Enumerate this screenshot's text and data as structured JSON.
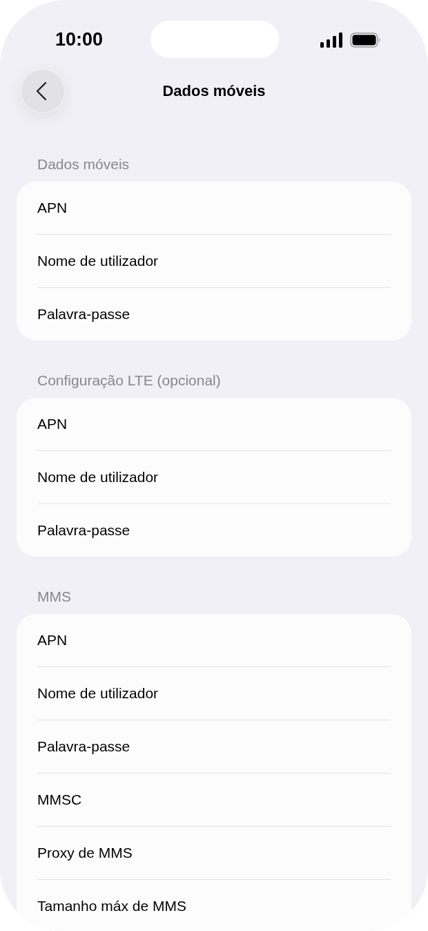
{
  "status_bar": {
    "time": "10:00"
  },
  "nav": {
    "title": "Dados móveis"
  },
  "sections": [
    {
      "header": "Dados móveis",
      "rows": [
        "APN",
        "Nome de utilizador",
        "Palavra-passe"
      ]
    },
    {
      "header": "Configuração LTE (opcional)",
      "rows": [
        "APN",
        "Nome de utilizador",
        "Palavra-passe"
      ]
    },
    {
      "header": "MMS",
      "rows": [
        "APN",
        "Nome de utilizador",
        "Palavra-passe",
        "MMSC",
        "Proxy de MMS",
        "Tamanho máx de MMS"
      ]
    }
  ]
}
